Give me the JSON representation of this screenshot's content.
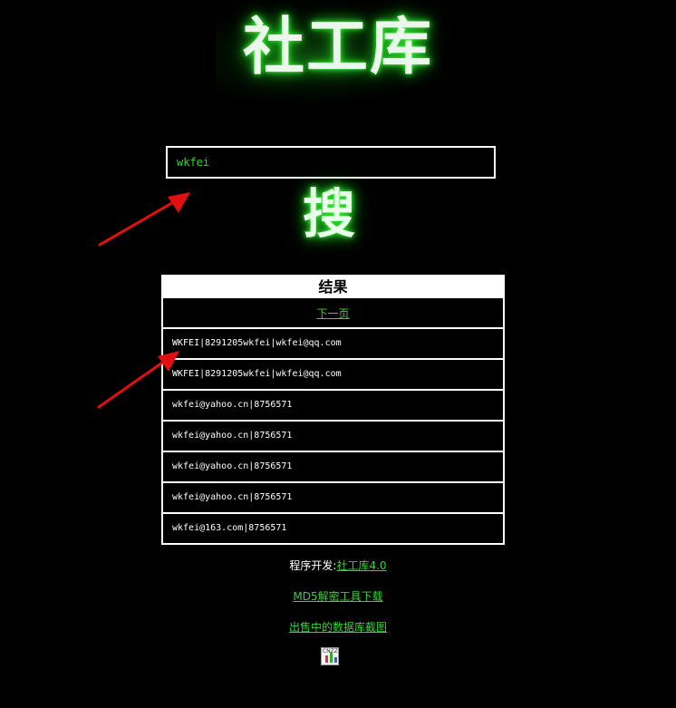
{
  "logo": {
    "text": "社工库"
  },
  "search": {
    "value": "wkfei",
    "button_label": "搜"
  },
  "results": {
    "header": "结果",
    "next_page": "下一页",
    "rows": [
      "WKFEI|8291205wkfei|wkfei@qq.com",
      "WKFEI|8291205wkfei|wkfei@qq.com",
      "wkfei@yahoo.cn|8756571",
      "wkfei@yahoo.cn|8756571",
      "wkfei@yahoo.cn|8756571",
      "wkfei@yahoo.cn|8756571",
      "wkfei@163.com|8756571"
    ]
  },
  "footer": {
    "developer_label": "程序开发:",
    "developer_link": "社工库4.0",
    "md5_link": "MD5解密工具下载",
    "screenshot_link": "出售中的数据库截图",
    "stat_icon_text": "CNZZ"
  },
  "colors": {
    "link": "#3ad13a",
    "glow": "#1fbf1f",
    "arrow": "#e01010"
  },
  "icons": {
    "stat": "cnzz-stats-icon",
    "annotation": "red-arrow-icon"
  }
}
